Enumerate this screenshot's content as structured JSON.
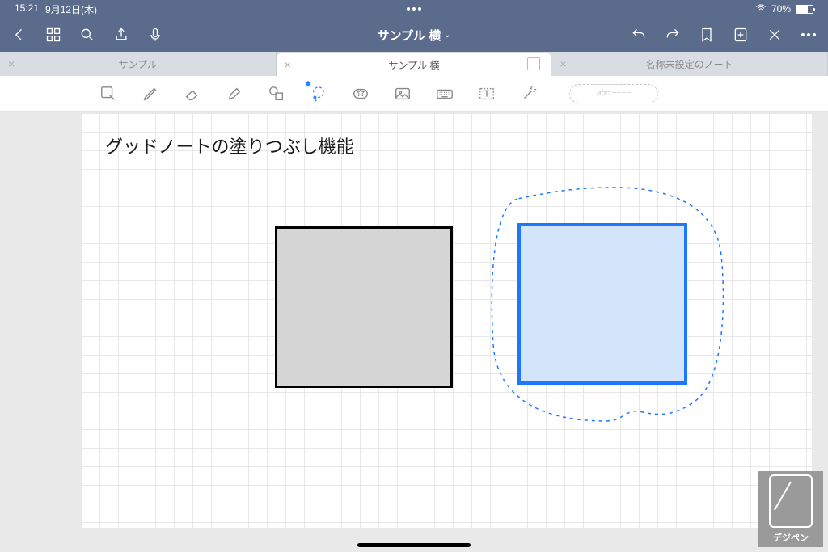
{
  "status": {
    "time": "15:21",
    "date": "9月12日(木)",
    "battery_pct": "70%"
  },
  "nav": {
    "title": "サンプル 横"
  },
  "tabs": [
    {
      "label": "サンプル",
      "active": false
    },
    {
      "label": "サンプル 横",
      "active": true
    },
    {
      "label": "名称未設定のノート",
      "active": false
    }
  ],
  "toolbar": {
    "handwriting_placeholder": "abc ~~~~"
  },
  "canvas": {
    "title_text": "グッドノートの塗りつぶし機能"
  },
  "watermark": {
    "label": "デジペン"
  },
  "colors": {
    "brand_bar": "#5a6b8c",
    "selection_blue": "#1d78ff",
    "fill_blue": "#d3e5fb",
    "fill_gray": "#d6d6d6"
  }
}
